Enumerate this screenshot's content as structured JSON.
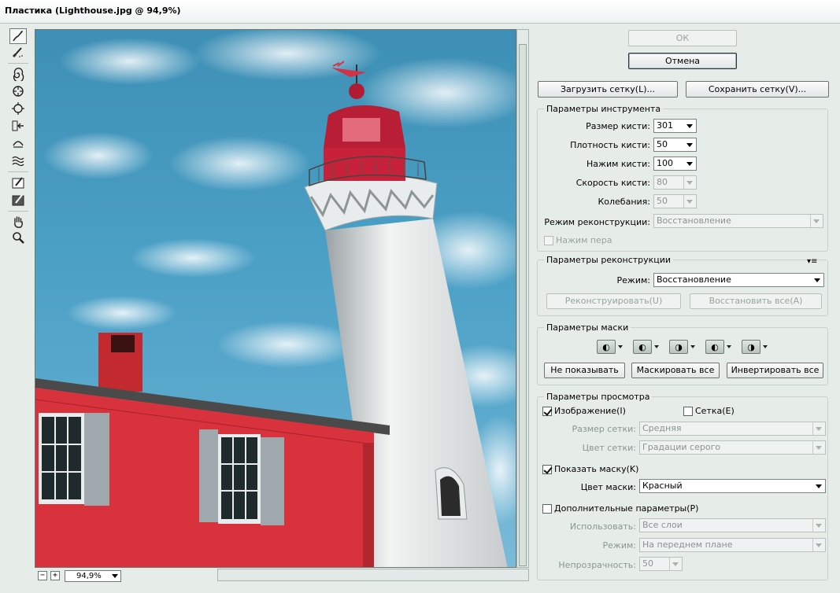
{
  "window": {
    "title": "Пластика (Lighthouse.jpg @ 94,9%)"
  },
  "toolbar": {
    "tools": [
      "forward-warp-tool",
      "reconstruct-tool",
      "twirl-tool",
      "pucker-tool",
      "bloat-tool",
      "push-left-tool",
      "mirror-tool",
      "turbulence-tool",
      "freeze-mask-tool",
      "thaw-mask-tool",
      "hand-tool",
      "zoom-tool"
    ]
  },
  "canvas": {
    "image": "Lighthouse.jpg"
  },
  "zoom": {
    "minus": "−",
    "plus": "+",
    "value": "94,9%"
  },
  "buttons": {
    "ok": "ОК",
    "cancel": "Отмена",
    "load_mesh": "Загрузить сетку(L)...",
    "save_mesh": "Сохранить сетку(V)..."
  },
  "tool_options": {
    "legend": "Параметры инструмента",
    "brush_size_label": "Размер кисти:",
    "brush_size": "301",
    "brush_density_label": "Плотность кисти:",
    "brush_density": "50",
    "brush_pressure_label": "Нажим кисти:",
    "brush_pressure": "100",
    "brush_rate_label": "Скорость кисти:",
    "brush_rate": "80",
    "turbulent_jitter_label": "Колебания:",
    "turbulent_jitter": "50",
    "reconstruct_mode_label": "Режим реконструкции:",
    "reconstruct_mode": "Восстановление",
    "stylus_pressure": "Нажим пера"
  },
  "reconstruct_options": {
    "legend": "Параметры реконструкции",
    "mode_label": "Режим:",
    "mode": "Восстановление",
    "reconstruct": "Реконструировать(U)",
    "restore_all": "Восстановить все(A)"
  },
  "mask_options": {
    "legend": "Параметры маски",
    "none": "Не показывать",
    "mask_all": "Маскировать все",
    "invert_all": "Инвертировать все"
  },
  "view_options": {
    "legend": "Параметры просмотра",
    "show_image": "Изображение(I)",
    "show_mesh": "Сетка(E)",
    "mesh_size_label": "Размер сетки:",
    "mesh_size": "Средняя",
    "mesh_color_label": "Цвет сетки:",
    "mesh_color": "Градации серого",
    "show_mask": "Показать маску(K)",
    "mask_color_label": "Цвет маски:",
    "mask_color": "Красный",
    "show_backdrop": "Дополнительные параметры(P)",
    "use_label": "Использовать:",
    "use": "Все слои",
    "mode_label": "Режим:",
    "mode": "На переднем плане",
    "opacity_label": "Непрозрачность:",
    "opacity": "50"
  },
  "colors": {
    "sky": "#4a9fc5",
    "building": "#d8323c",
    "lighthouse": "#eef0ee"
  }
}
